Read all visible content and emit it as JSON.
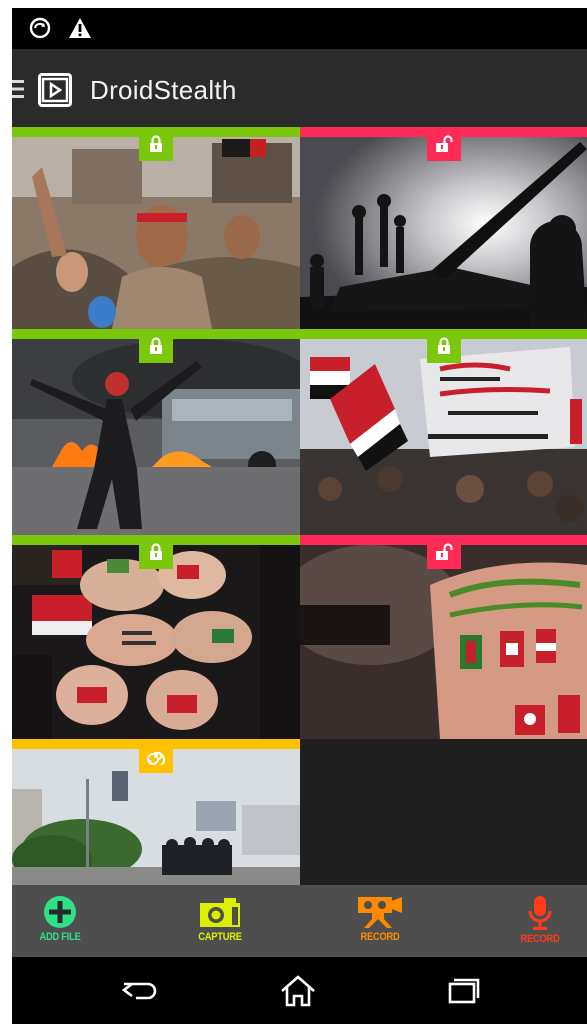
{
  "app": {
    "title": "DroidStealth"
  },
  "colors": {
    "locked": "#7ac70c",
    "unlocked": "#ff2a55",
    "pending": "#ffc200",
    "add": "#2ee08a",
    "capture": "#d9f000",
    "video": "#ff8a00",
    "audio": "#ff3b1a"
  },
  "tiles": [
    {
      "status": "locked",
      "badge": "lock-icon"
    },
    {
      "status": "unlocked",
      "badge": "unlock-icon"
    },
    {
      "status": "locked",
      "badge": "lock-icon"
    },
    {
      "status": "locked",
      "badge": "lock-icon"
    },
    {
      "status": "locked",
      "badge": "lock-icon"
    },
    {
      "status": "unlocked",
      "badge": "unlock-icon"
    },
    {
      "status": "pending",
      "badge": "spinner-icon"
    }
  ],
  "toolbar": {
    "add_label": "ADD FILE",
    "capture_label": "CAPTURE",
    "video_label": "RECORD",
    "audio_label": "RECORD"
  },
  "navbar": {
    "items": [
      "back-icon",
      "home-icon",
      "recents-icon"
    ]
  }
}
